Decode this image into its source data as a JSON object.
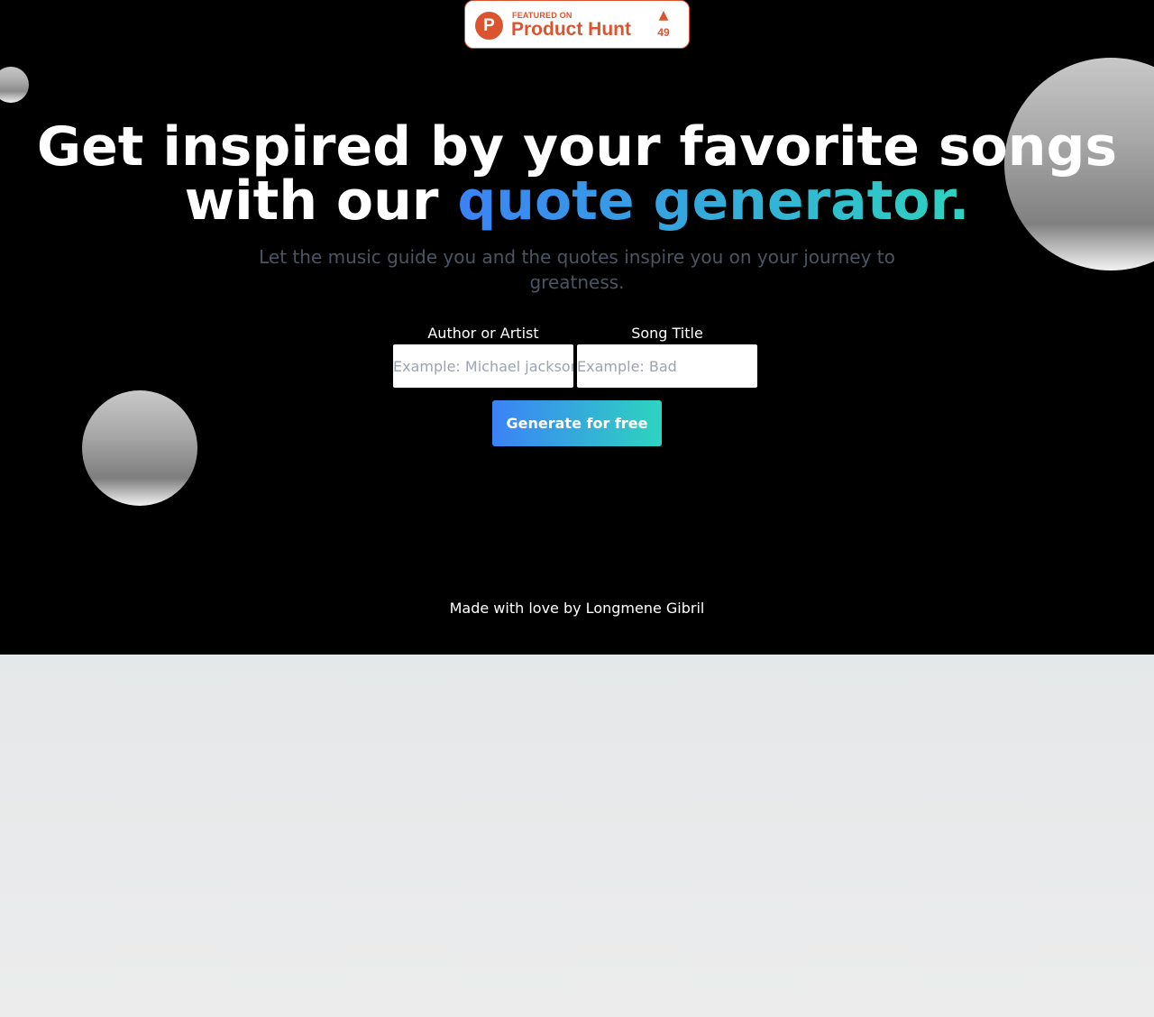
{
  "badge": {
    "featured_label": "FEATURED ON",
    "name": "Product Hunt",
    "logo_letter": "P",
    "upvote_arrow": "▲",
    "upvote_count": "49",
    "color": "#da552f"
  },
  "hero": {
    "headline_line1": "Get inspired by your favorite songs",
    "headline_line2_prefix": "with our",
    "headline_highlight": "quote generator.",
    "subtitle": "Let the music guide you and the quotes inspire you on your journey to greatness."
  },
  "form": {
    "author_label": "Author or Artist",
    "author_placeholder": "Example: Michael jackson",
    "song_label": "Song Title",
    "song_placeholder": "Example: Bad",
    "generate_button": "Generate for free"
  },
  "footer": {
    "credit": "Made with love by Longmene Gibril"
  },
  "colors": {
    "gradient_start": "#3b82f6",
    "gradient_end": "#2dd4bf",
    "hero_background": "#000000"
  }
}
